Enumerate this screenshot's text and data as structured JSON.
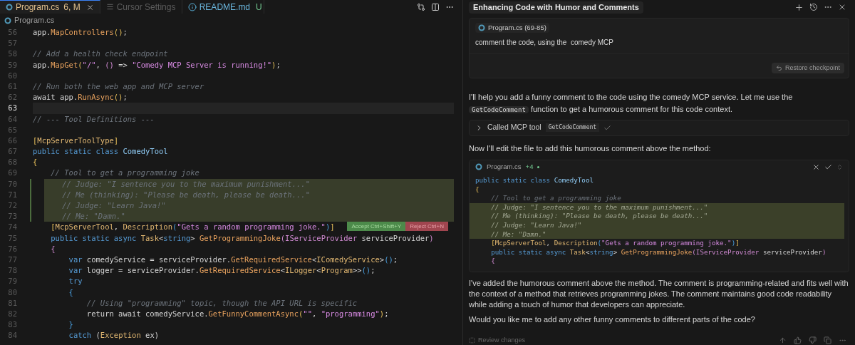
{
  "editor": {
    "tabs": [
      {
        "label": "Program.cs",
        "badge": "6, M",
        "selected": true,
        "closable": true
      },
      {
        "label": "Cursor Settings",
        "selected": false,
        "closable": false
      },
      {
        "label": "README.md",
        "badge": "U",
        "selected": false,
        "closable": false
      }
    ],
    "breadcrumb": "Program.cs",
    "lines": [
      {
        "number": "56",
        "kind": "normal",
        "tokens": [
          {
            "kind": "plain",
            "text": "app."
          },
          {
            "kind": "method",
            "text": "MapControllers"
          },
          {
            "kind": "bracket",
            "text": "()"
          },
          {
            "kind": "plain",
            "text": ";"
          }
        ]
      },
      {
        "number": "57",
        "kind": "normal"
      },
      {
        "number": "58",
        "kind": "normal",
        "tokens": [
          {
            "kind": "comment",
            "text": "// Add a health check endpoint"
          }
        ]
      },
      {
        "number": "59",
        "kind": "normal",
        "tokens": [
          {
            "kind": "plain",
            "text": "app."
          },
          {
            "kind": "method",
            "text": "MapGet"
          },
          {
            "kind": "bracket",
            "text": "("
          },
          {
            "kind": "string",
            "text": "\"/\""
          },
          {
            "kind": "plain",
            "text": ", "
          },
          {
            "kind": "iface",
            "text": "()"
          },
          {
            "kind": "plain",
            "text": " => "
          },
          {
            "kind": "string",
            "text": "\"Comedy MCP Server is running!\""
          },
          {
            "kind": "bracket",
            "text": ")"
          },
          {
            "kind": "plain",
            "text": ";"
          }
        ]
      },
      {
        "number": "60",
        "kind": "normal"
      },
      {
        "number": "61",
        "kind": "normal",
        "tokens": [
          {
            "kind": "comment",
            "text": "// Run both the web app and MCP server"
          }
        ]
      },
      {
        "number": "62",
        "kind": "normal",
        "tokens": [
          {
            "kind": "plain",
            "text": "await app."
          },
          {
            "kind": "method",
            "text": "RunAsync"
          },
          {
            "kind": "bracket",
            "text": "()"
          },
          {
            "kind": "plain",
            "text": ";"
          }
        ]
      },
      {
        "number": "63",
        "kind": "active"
      },
      {
        "number": "64",
        "kind": "normal",
        "tokens": [
          {
            "kind": "comment",
            "text": "// --- Tool Definitions ---"
          }
        ]
      },
      {
        "number": "65",
        "kind": "normal"
      },
      {
        "number": "66",
        "kind": "normal",
        "tokens": [
          {
            "kind": "bracket",
            "text": "["
          },
          {
            "kind": "type",
            "text": "McpServerToolType"
          },
          {
            "kind": "bracket",
            "text": "]"
          }
        ]
      },
      {
        "number": "67",
        "kind": "normal",
        "tokens": [
          {
            "kind": "keyword",
            "text": "public static class "
          },
          {
            "kind": "class",
            "text": "ComedyTool"
          }
        ]
      },
      {
        "number": "68",
        "kind": "normal",
        "tokens": [
          {
            "kind": "bracket",
            "text": "{"
          }
        ]
      },
      {
        "number": "69",
        "kind": "normal",
        "tokens": [
          {
            "kind": "comment",
            "text": "    // Tool to get a programming joke"
          }
        ]
      },
      {
        "number": "70",
        "kind": "added",
        "tokens": [
          {
            "kind": "comment",
            "text": "    // Judge: \"I sentence you to the maximum punishment...\""
          }
        ]
      },
      {
        "number": "71",
        "kind": "added",
        "tokens": [
          {
            "kind": "comment",
            "text": "    // Me (thinking): \"Please be death, please be death...\""
          }
        ]
      },
      {
        "number": "72",
        "kind": "added",
        "tokens": [
          {
            "kind": "comment",
            "text": "    // Judge: \"Learn Java!\""
          }
        ]
      },
      {
        "number": "73",
        "kind": "added",
        "tokens": [
          {
            "kind": "comment",
            "text": "    // Me: \"Damn.\""
          }
        ]
      },
      {
        "number": "74",
        "kind": "normal",
        "tokens": [
          {
            "kind": "bracket",
            "text": "    ["
          },
          {
            "kind": "type",
            "text": "McpServerTool"
          },
          {
            "kind": "plain",
            "text": ", "
          },
          {
            "kind": "type",
            "text": "Description"
          },
          {
            "kind": "bracket2",
            "text": "("
          },
          {
            "kind": "string",
            "text": "\"Gets a random programming joke.\""
          },
          {
            "kind": "bracket2",
            "text": ")"
          },
          {
            "kind": "bracket",
            "text": "]"
          }
        ],
        "actions": [
          {
            "label": "Accept Ctrl+Shift+Y",
            "kind": "accept"
          },
          {
            "label": "Reject Ctrl+N",
            "kind": "reject"
          }
        ]
      },
      {
        "number": "75",
        "kind": "normal",
        "tokens": [
          {
            "kind": "keyword",
            "text": "    public static async "
          },
          {
            "kind": "type",
            "text": "Task"
          },
          {
            "kind": "plain",
            "text": "<"
          },
          {
            "kind": "keyword",
            "text": "string"
          },
          {
            "kind": "plain",
            "text": "> "
          },
          {
            "kind": "method",
            "text": "GetProgrammingJoke"
          },
          {
            "kind": "iface",
            "text": "(IServiceProvider "
          },
          {
            "kind": "plain",
            "text": "serviceProvider"
          },
          {
            "kind": "iface",
            "text": ")"
          }
        ]
      },
      {
        "number": "76",
        "kind": "normal",
        "tokens": [
          {
            "kind": "iface",
            "text": "    {"
          }
        ]
      },
      {
        "number": "77",
        "kind": "normal",
        "tokens": [
          {
            "kind": "keyword",
            "text": "        var "
          },
          {
            "kind": "plain",
            "text": "comedyService = serviceProvider."
          },
          {
            "kind": "method",
            "text": "GetRequiredService"
          },
          {
            "kind": "plain",
            "text": "<"
          },
          {
            "kind": "type",
            "text": "IComedyService"
          },
          {
            "kind": "plain",
            "text": ">"
          },
          {
            "kind": "bracket2",
            "text": "()"
          },
          {
            "kind": "plain",
            "text": ";"
          }
        ]
      },
      {
        "number": "78",
        "kind": "normal",
        "tokens": [
          {
            "kind": "keyword",
            "text": "        var "
          },
          {
            "kind": "plain",
            "text": "logger = serviceProvider."
          },
          {
            "kind": "method",
            "text": "GetRequiredService"
          },
          {
            "kind": "plain",
            "text": "<"
          },
          {
            "kind": "type",
            "text": "ILogger"
          },
          {
            "kind": "plain",
            "text": "<"
          },
          {
            "kind": "type",
            "text": "Program"
          },
          {
            "kind": "plain",
            "text": ">>"
          },
          {
            "kind": "bracket2",
            "text": "()"
          },
          {
            "kind": "plain",
            "text": ";"
          }
        ]
      },
      {
        "number": "79",
        "kind": "normal",
        "tokens": [
          {
            "kind": "keyword",
            "text": "        try"
          }
        ]
      },
      {
        "number": "80",
        "kind": "normal",
        "tokens": [
          {
            "kind": "bracket2",
            "text": "        {"
          }
        ]
      },
      {
        "number": "81",
        "kind": "normal",
        "tokens": [
          {
            "kind": "comment",
            "text": "            // Using \"programming\" topic, though the API URL is specific"
          }
        ]
      },
      {
        "number": "82",
        "kind": "normal",
        "tokens": [
          {
            "kind": "plain",
            "text": "            return await comedyService."
          },
          {
            "kind": "method",
            "text": "GetFunnyCommentAsync"
          },
          {
            "kind": "bracket",
            "text": "("
          },
          {
            "kind": "string",
            "text": "\"\""
          },
          {
            "kind": "plain",
            "text": ", "
          },
          {
            "kind": "string",
            "text": "\"programming\""
          },
          {
            "kind": "bracket",
            "text": ")"
          },
          {
            "kind": "plain",
            "text": ";"
          }
        ]
      },
      {
        "number": "83",
        "kind": "normal",
        "tokens": [
          {
            "kind": "bracket2",
            "text": "        }"
          }
        ]
      },
      {
        "number": "84",
        "kind": "normal",
        "tokens": [
          {
            "kind": "keyword",
            "text": "        catch "
          },
          {
            "kind": "plain",
            "text": "("
          },
          {
            "kind": "type",
            "text": "Exception"
          },
          {
            "kind": "plain",
            "text": " ex)"
          }
        ]
      }
    ]
  },
  "chat": {
    "title": "Enhancing Code with Humor and Comments",
    "user_message": {
      "context_chip": "Program.cs (69-85)",
      "text": "comment the code, using the  comedy MCP",
      "restore_button": "Restore checkpoint"
    },
    "reply_intro": [
      {
        "kind": "text",
        "text": "I'll help you add a funny comment to the code using the comedy MCP service. Let me use the "
      },
      {
        "kind": "code",
        "text": "GetCodeComment"
      },
      {
        "kind": "text",
        "text": " function to get a humorous comment for this code context."
      }
    ],
    "tool_call": {
      "label": "Called MCP tool",
      "tool": "GetCodeComment",
      "done": true,
      "expanded": false
    },
    "edit_intro": "Now I'll edit the file to add this humorous comment above the method:",
    "diff": {
      "file": "Program.cs",
      "added": "+4",
      "modified": true,
      "lines": [
        {
          "kind": "normal",
          "tokens": [
            {
              "kind": "keyword",
              "text": "public static class "
            },
            {
              "kind": "class",
              "text": "ComedyTool"
            }
          ]
        },
        {
          "kind": "normal",
          "tokens": [
            {
              "kind": "bracket",
              "text": "{"
            }
          ]
        },
        {
          "kind": "normal",
          "tokens": [
            {
              "kind": "comment",
              "text": "    // Tool to get a programming joke"
            }
          ]
        },
        {
          "kind": "added",
          "tokens": [
            {
              "kind": "comment",
              "text": "    // Judge: \"I sentence you to the maximum punishment...\""
            }
          ]
        },
        {
          "kind": "added",
          "tokens": [
            {
              "kind": "comment",
              "text": "    // Me (thinking): \"Please be death, please be death...\""
            }
          ]
        },
        {
          "kind": "added",
          "tokens": [
            {
              "kind": "comment",
              "text": "    // Judge: \"Learn Java!\""
            }
          ]
        },
        {
          "kind": "added",
          "tokens": [
            {
              "kind": "comment",
              "text": "    // Me: \"Damn.\""
            }
          ]
        },
        {
          "kind": "normal",
          "tokens": [
            {
              "kind": "bracket",
              "text": "    ["
            },
            {
              "kind": "type",
              "text": "McpServerTool"
            },
            {
              "kind": "plain",
              "text": ", "
            },
            {
              "kind": "type",
              "text": "Description"
            },
            {
              "kind": "bracket2",
              "text": "("
            },
            {
              "kind": "string",
              "text": "\"Gets a random programming joke.\""
            },
            {
              "kind": "bracket2",
              "text": ")"
            },
            {
              "kind": "bracket",
              "text": "]"
            }
          ]
        },
        {
          "kind": "normal",
          "tokens": [
            {
              "kind": "keyword",
              "text": "    public static async "
            },
            {
              "kind": "type",
              "text": "Task"
            },
            {
              "kind": "plain",
              "text": "<"
            },
            {
              "kind": "keyword",
              "text": "string"
            },
            {
              "kind": "plain",
              "text": "> "
            },
            {
              "kind": "method",
              "text": "GetProgrammingJoke"
            },
            {
              "kind": "iface",
              "text": "(IServiceProvider "
            },
            {
              "kind": "plain",
              "text": "serviceProvider"
            },
            {
              "kind": "iface",
              "text": ")"
            }
          ]
        },
        {
          "kind": "normal",
          "tokens": [
            {
              "kind": "iface",
              "text": "    {"
            }
          ]
        }
      ]
    },
    "summary": "I've added the humorous comment above the method. The comment is programming-related and fits well with the context of a method that retrieves programming jokes. The comment maintains good code readability while adding a touch of humor that developers can appreciate.",
    "question": "Would you like me to add any other funny comments to different parts of the code?",
    "review_button": "Review changes"
  }
}
